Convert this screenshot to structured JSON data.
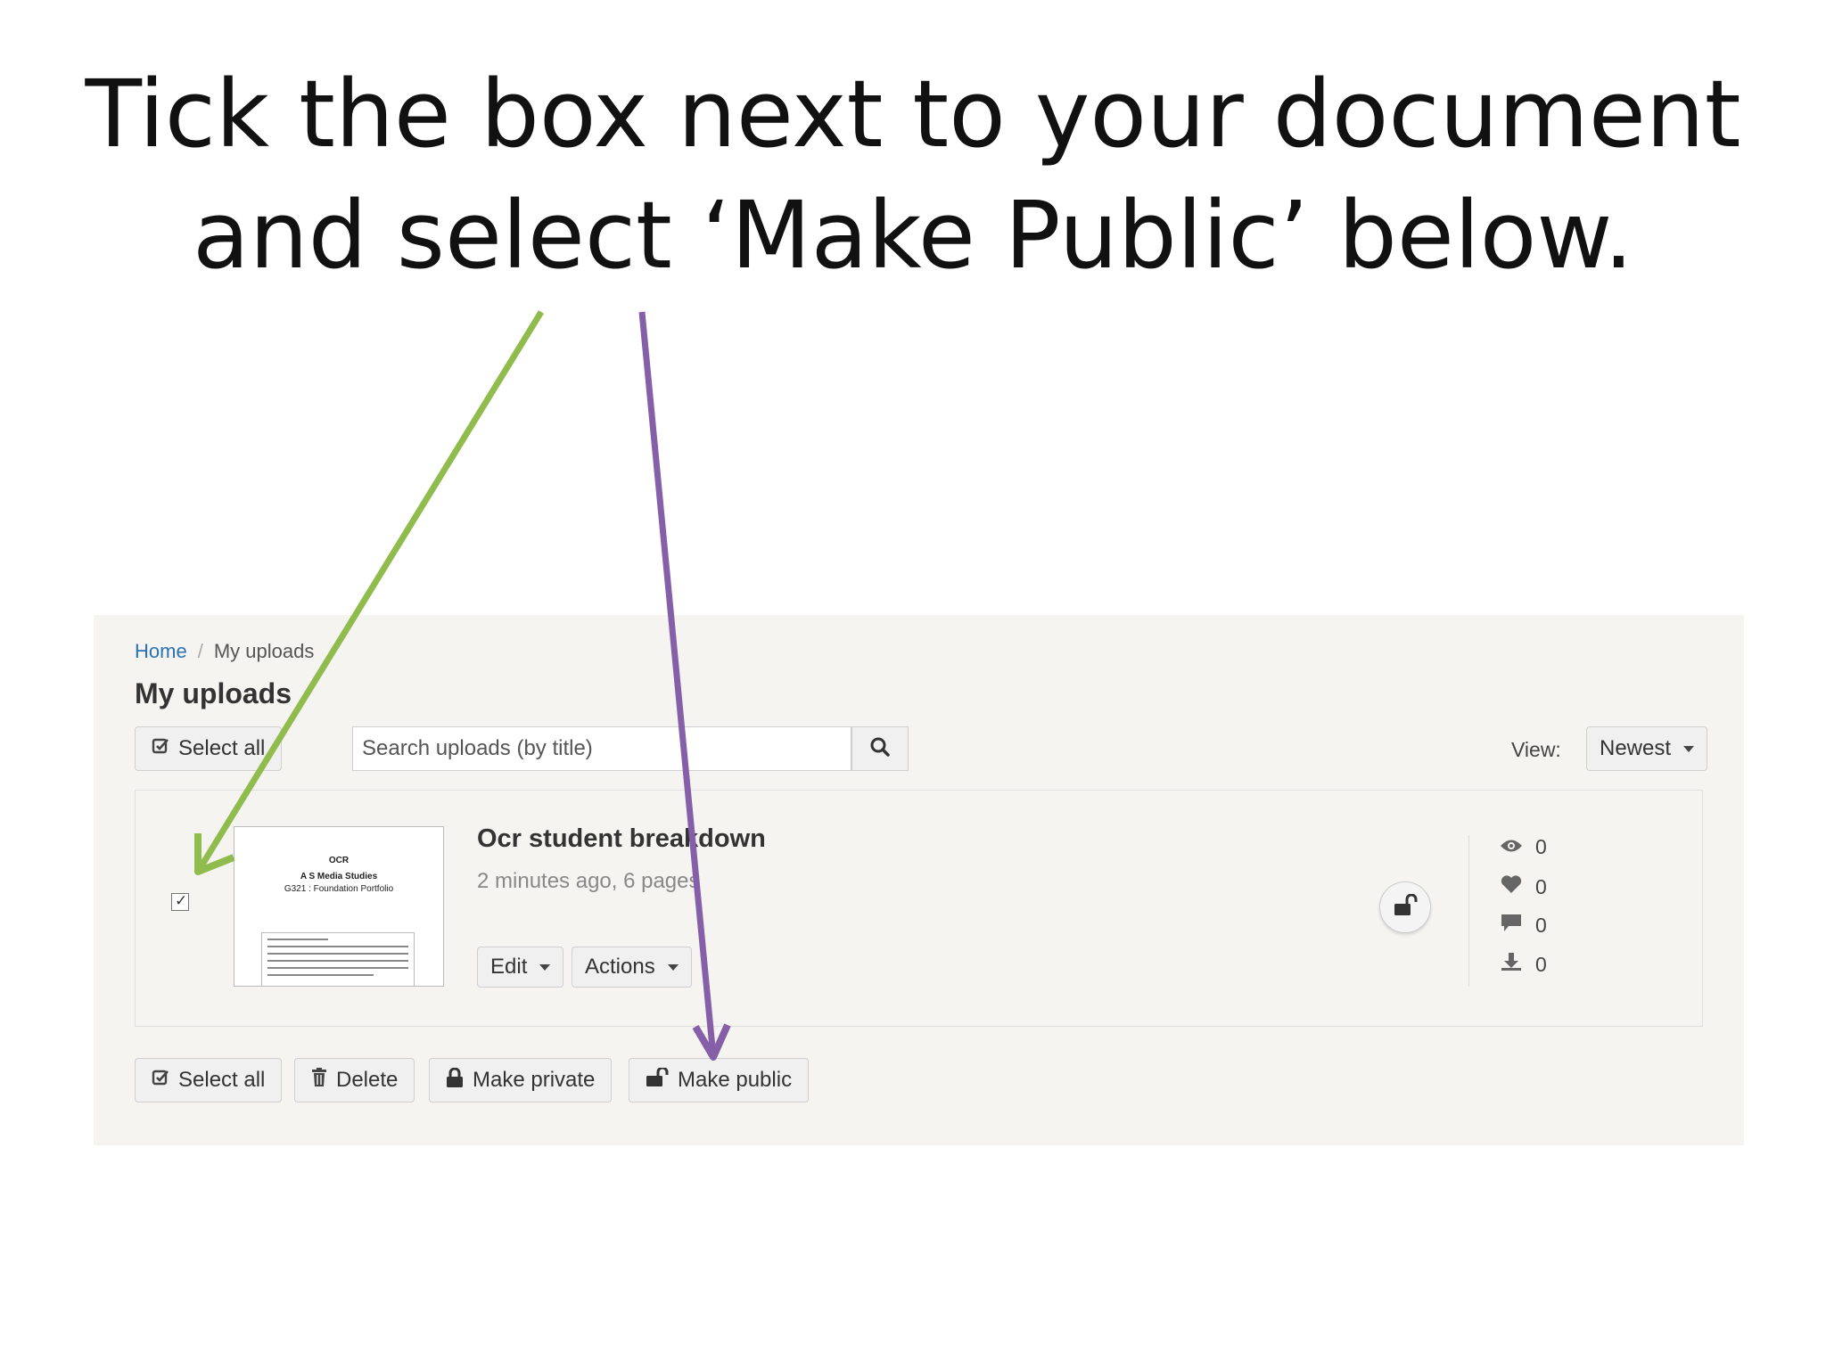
{
  "slide": {
    "title_line1": "Tick the box next to your document",
    "title_line2": "and select ‘Make Public’ below."
  },
  "breadcrumb": {
    "home": "Home",
    "separator": "/",
    "current": "My uploads"
  },
  "page": {
    "heading": "My uploads"
  },
  "toolbar": {
    "select_all_label": "Select all",
    "search_placeholder": "Search uploads (by title)",
    "view_label": "View:",
    "view_selected": "Newest"
  },
  "upload": {
    "checked": true,
    "title": "Ocr student breakdown",
    "meta": "2 minutes ago, 6 pages",
    "edit_label": "Edit",
    "actions_label": "Actions",
    "thumbnail": {
      "line1": "OCR",
      "line2": "A S Media Studies",
      "line3": "G321 : Foundation Portfolio"
    },
    "stats": {
      "views": "0",
      "likes": "0",
      "comments": "0",
      "downloads": "0"
    }
  },
  "bulk_actions": {
    "select_all_label": "Select all",
    "delete_label": "Delete",
    "make_private_label": "Make private",
    "make_public_label": "Make public"
  },
  "annotation_colors": {
    "green_arrow": "#8fbc4c",
    "purple_arrow": "#8560a8"
  }
}
